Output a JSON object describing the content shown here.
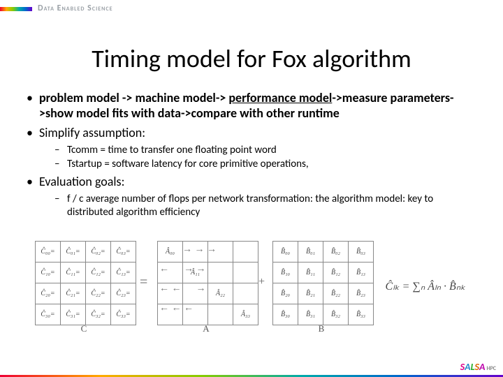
{
  "brand": "Data Enabled Science",
  "title": "Timing model for Fox algorithm",
  "bullets": {
    "b1_lead": "problem model -> machine model-> ",
    "b1_uline": "performance model",
    "b1_tail": "->measure parameters->show model fits with data->compare with other runtime",
    "b2": "Simplify assumption:",
    "b2a": "Tcomm = time to transfer one floating point word",
    "b2b": "Tstartup = software latency for core primitive operations,",
    "b3": "Evaluation goals:",
    "b3a": "f / c average number of flops per network transformation: the algorithm model: key to distributed algorithm efficiency"
  },
  "fig": {
    "eq": "=",
    "plus": "+",
    "labels": {
      "C": "C",
      "A": "A",
      "B": "B"
    },
    "C": [
      [
        "Ĉ₀₀=",
        "Ĉ₀₁=",
        "Ĉ₀₂=",
        "Ĉ₀₃="
      ],
      [
        "Ĉ₁₀=",
        "Ĉ₁₁=",
        "Ĉ₁₂=",
        "Ĉ₁₃="
      ],
      [
        "Ĉ₂₀=",
        "Ĉ₂₁=",
        "Ĉ₂₂=",
        "Ĉ₂₃="
      ],
      [
        "Ĉ₃₀=",
        "Ĉ₃₁=",
        "Ĉ₃₂=",
        "Ĉ₃₃="
      ]
    ],
    "A": [
      "Â₀₀",
      "Â₁₁",
      "Â₂₂",
      "Â₃₃"
    ],
    "B": [
      [
        "B̂₀₀",
        "B̂₀₁",
        "B̂₀₂",
        "B̂₀₃"
      ],
      [
        "B̂₁₀",
        "B̂₁₁",
        "B̂₁₂",
        "B̂₁₃"
      ],
      [
        "B̂₂₀",
        "B̂₂₁",
        "B̂₂₂",
        "B̂₂₃"
      ],
      [
        "B̂₃₀",
        "B̂₃₁",
        "B̂₃₂",
        "B̂₃₃"
      ]
    ],
    "formula": "Ĉₗₖ = ∑ₙ Âₗₙ · B̂ₙₖ"
  },
  "salsa": {
    "s1": "S",
    "s2": "A",
    "s3": "L",
    "s4": "S",
    "s5": "A",
    "hpc": "HPC"
  }
}
